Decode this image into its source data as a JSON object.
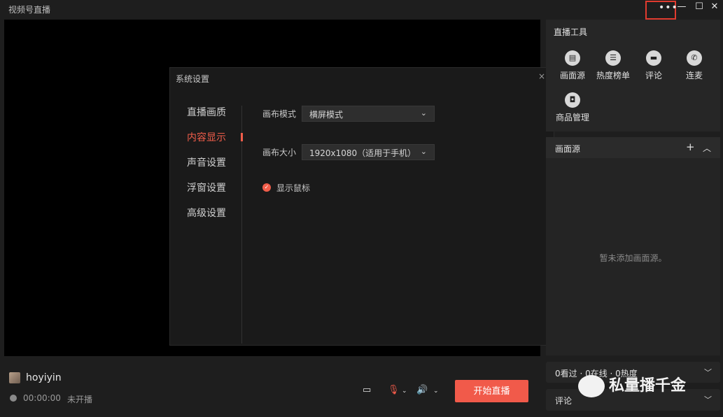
{
  "app": {
    "title": "视频号直播",
    "more_icon": "more-horizontal-icon"
  },
  "dialog": {
    "title": "系统设置",
    "close": "×",
    "nav": [
      "直播画质",
      "内容显示",
      "声音设置",
      "浮窗设置",
      "高级设置"
    ],
    "active_nav_index": 1,
    "canvas_mode_label": "画布模式",
    "canvas_mode_value": "横屏模式",
    "canvas_size_label": "画布大小",
    "canvas_size_value": "1920x1080（适用于手机）",
    "show_cursor_label": "显示鼠标",
    "show_cursor_checked": true
  },
  "tools": {
    "title": "直播工具",
    "items": [
      {
        "label": "画面源",
        "icon": "document-icon"
      },
      {
        "label": "热度榜单",
        "icon": "list-icon"
      },
      {
        "label": "评论",
        "icon": "comment-icon"
      },
      {
        "label": "连麦",
        "icon": "phone-icon"
      },
      {
        "label": "商品管理",
        "icon": "shopping-bag-icon"
      }
    ]
  },
  "sources": {
    "title": "画面源",
    "empty": "暂未添加画面源。"
  },
  "stats": {
    "text": "0看过 · 0在线 · 0热度"
  },
  "comments": {
    "label": "评论"
  },
  "user": {
    "name": "hoyiyin",
    "timer": "00:00:00",
    "status": "未开播"
  },
  "controls": {
    "start_label": "开始直播"
  },
  "watermark": {
    "text": "私量播千金"
  },
  "colors": {
    "accent": "#f15a4a",
    "bg": "#1e1e1e"
  }
}
